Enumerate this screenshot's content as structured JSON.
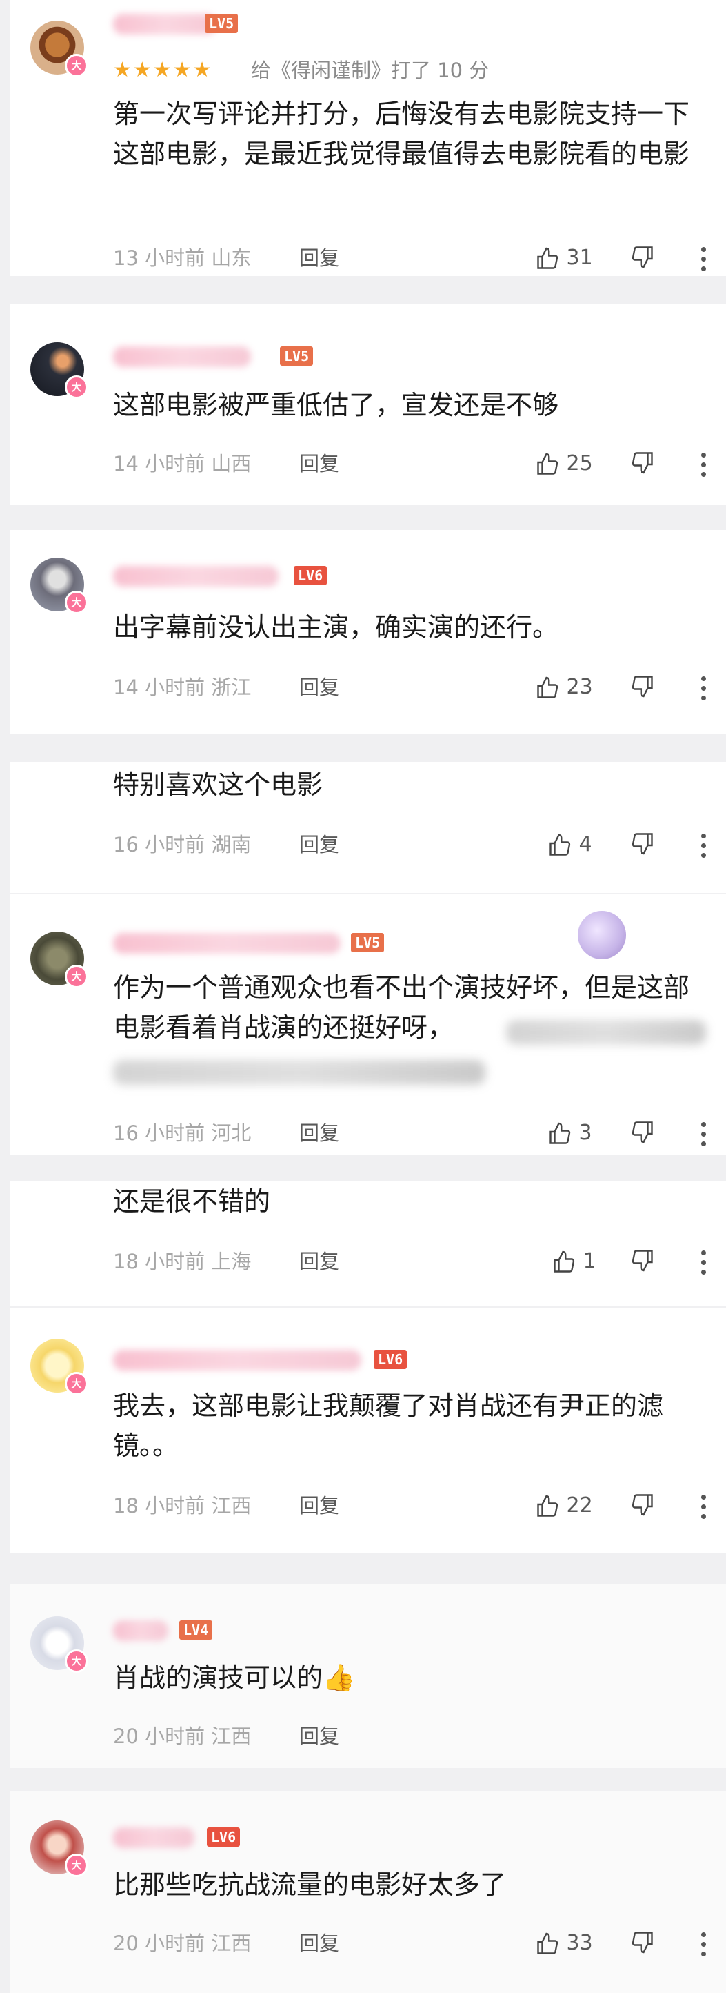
{
  "comments": [
    {
      "rating_stars": "★★★★★",
      "rating_text": "给《得闲谨制》打了 10 分",
      "level": "LV5",
      "text": "第一次写评论并打分，后悔没有去电影院支持一下这部电影，是最近我觉得最值得去电影院看的电影",
      "meta": "13 小时前 山东",
      "reply": "回复",
      "likes": "31"
    },
    {
      "level": "LV5",
      "text": "这部电影被严重低估了，宣发还是不够",
      "meta": "14 小时前 山西",
      "reply": "回复",
      "likes": "25"
    },
    {
      "level": "LV6",
      "text": "出字幕前没认出主演，确实演的还行。",
      "meta": "14 小时前 浙江",
      "reply": "回复",
      "likes": "23"
    },
    {
      "text": "特别喜欢这个电影",
      "meta": "16 小时前 湖南",
      "reply": "回复",
      "likes": "4"
    },
    {
      "level": "LV5",
      "text": "作为一个普通观众也看不出个演技好坏，但是这部电影看着肖战演的还挺好呀，",
      "meta": "16 小时前 河北",
      "reply": "回复",
      "likes": "3"
    },
    {
      "text": "还是很不错的",
      "meta": "18 小时前 上海",
      "reply": "回复",
      "likes": "1"
    },
    {
      "level": "LV6",
      "text": "我去，这部电影让我颠覆了对肖战还有尹正的滤镜。。",
      "meta": "18 小时前 江西",
      "reply": "回复",
      "likes": "22"
    },
    {
      "level": "LV4",
      "text": "肖战的演技可以的👍",
      "meta": "20 小时前 江西",
      "reply": "回复",
      "likes": ""
    },
    {
      "level": "LV6",
      "text": "比那些吃抗战流量的电影好太多了",
      "meta": "20 小时前 江西",
      "reply": "回复",
      "likes": "33"
    }
  ],
  "badge": "大",
  "colors": {
    "accent_pink": "#fb7299",
    "level_orange": "#e8704a",
    "star": "#f5a623"
  }
}
